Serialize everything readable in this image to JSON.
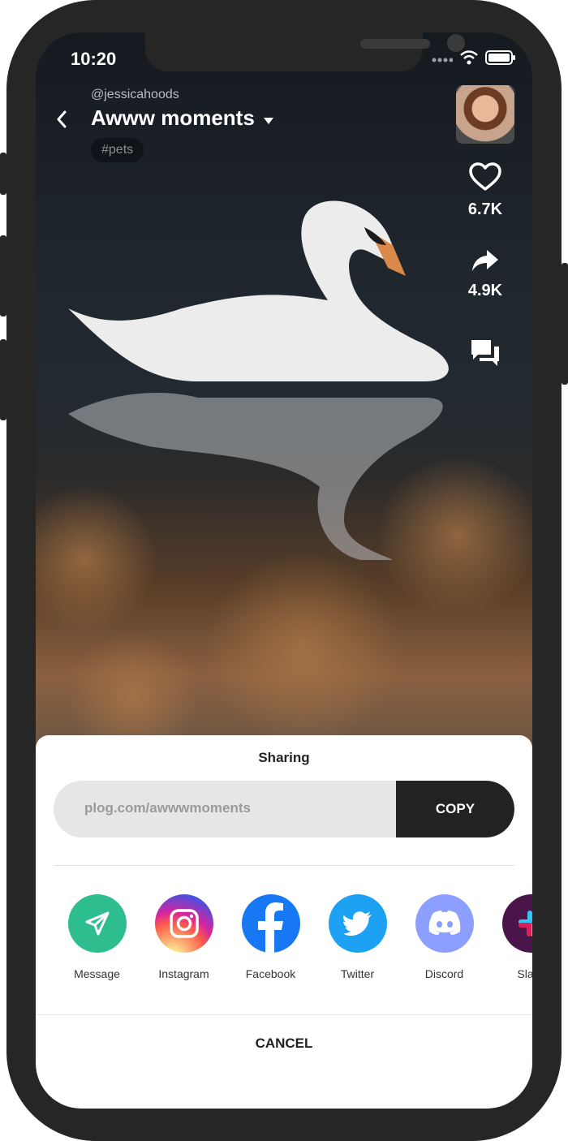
{
  "status": {
    "time": "10:20"
  },
  "post": {
    "username": "@jessicahoods",
    "title": "Awww moments",
    "tag": "#pets"
  },
  "actions": {
    "likes": "6.7K",
    "shares": "4.9K"
  },
  "sheet": {
    "title": "Sharing",
    "url": "plog.com/awwwmoments",
    "copy_label": "COPY",
    "apps": [
      {
        "label": "Message",
        "icon": "send-icon",
        "color": "#2dbd8f"
      },
      {
        "label": "Instagram",
        "icon": "instagram-icon",
        "color": "#d6249f"
      },
      {
        "label": "Facebook",
        "icon": "facebook-icon",
        "color": "#1877f2"
      },
      {
        "label": "Twitter",
        "icon": "twitter-icon",
        "color": "#1da1f2"
      },
      {
        "label": "Discord",
        "icon": "discord-icon",
        "color": "#8c9eff"
      },
      {
        "label": "Slack",
        "icon": "slack-icon",
        "color": "#4a154b"
      }
    ],
    "cancel_label": "CANCEL"
  }
}
